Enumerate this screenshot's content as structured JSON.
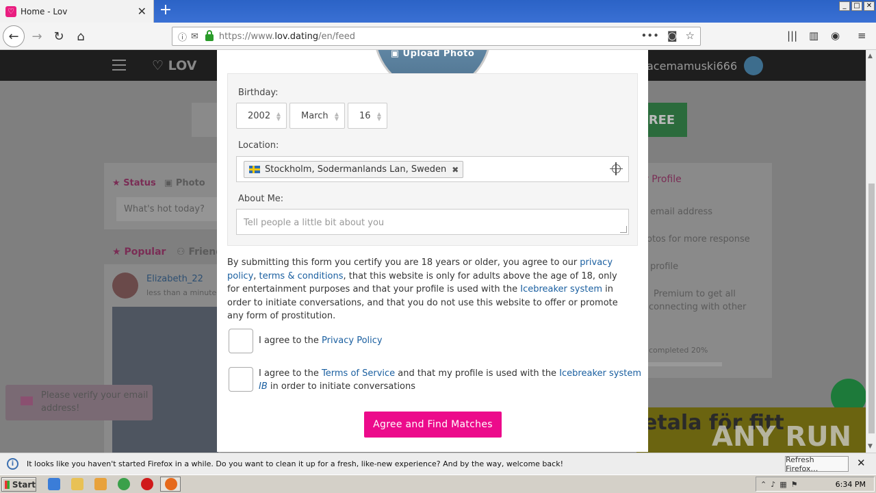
{
  "browser": {
    "tab_title": "Home - Lov",
    "tab_close": "✕",
    "new_tab": "+",
    "url_prefix": "https://www.",
    "url_domain": "lov.dating",
    "url_path": "/en/feed",
    "page_actions": "•••"
  },
  "background": {
    "logo": "LOV",
    "username": "acemamuski666",
    "free_button": "REE",
    "status_tab": "Status",
    "photo_tab": "Photo",
    "whats_hot": "What's hot today?",
    "popular_tab": "Popular",
    "friends_tab": "Friend",
    "poster_name": "Elizabeth_22",
    "poster_time": "less than a minute",
    "profile_header": "r Profile",
    "profile_items": [
      "email address",
      "otos for more response",
      "profile",
      "Premium to get all",
      "connecting with other"
    ],
    "profile_completed": "completed 20%",
    "verify_notice": "Please verify your email address!",
    "ad_text": "etala för fitt"
  },
  "modal": {
    "upload_photo": "Upload Photo",
    "birthday_label": "Birthday:",
    "birthday": {
      "year": "2002",
      "month": "March",
      "day": "16"
    },
    "location_label": "Location:",
    "location_tag": "Stockholm, Sodermanlands Lan, Sweden",
    "about_label": "About Me:",
    "about_placeholder": "Tell people a little bit about you",
    "disclaimer": {
      "p1": "By submitting this form you certify you are 18 years or older, you agree to our ",
      "privacy_link": "privacy policy",
      "p2": ", ",
      "terms_link": "terms & conditions",
      "p3": ", that this website is only for adults above the age of 18, only for entertainment purposes and that your profile is used with the ",
      "icebreaker_link": "Icebreaker system",
      "p4": " in order to initiate conversations, and that you do not use this website to offer or promote any form of prostitution."
    },
    "agree_privacy": {
      "pre": "I agree to the ",
      "link": "Privacy Policy"
    },
    "agree_terms": {
      "pre": "I agree to the ",
      "link": "Terms of Service",
      "mid": " and that my profile is used with the ",
      "link2": "Icebreaker system ",
      "link2_italic": "IB",
      "post": " in order to initiate conversations"
    },
    "cta": "Agree and Find Matches"
  },
  "notification": {
    "message": "It looks like you haven't started Firefox in a while. Do you want to clean it up for a fresh, like-new experience? And by the way, welcome back!",
    "button": "Refresh Firefox…"
  },
  "taskbar": {
    "start": "Start",
    "clock": "6:34 PM"
  },
  "watermark": "ANY RUN"
}
